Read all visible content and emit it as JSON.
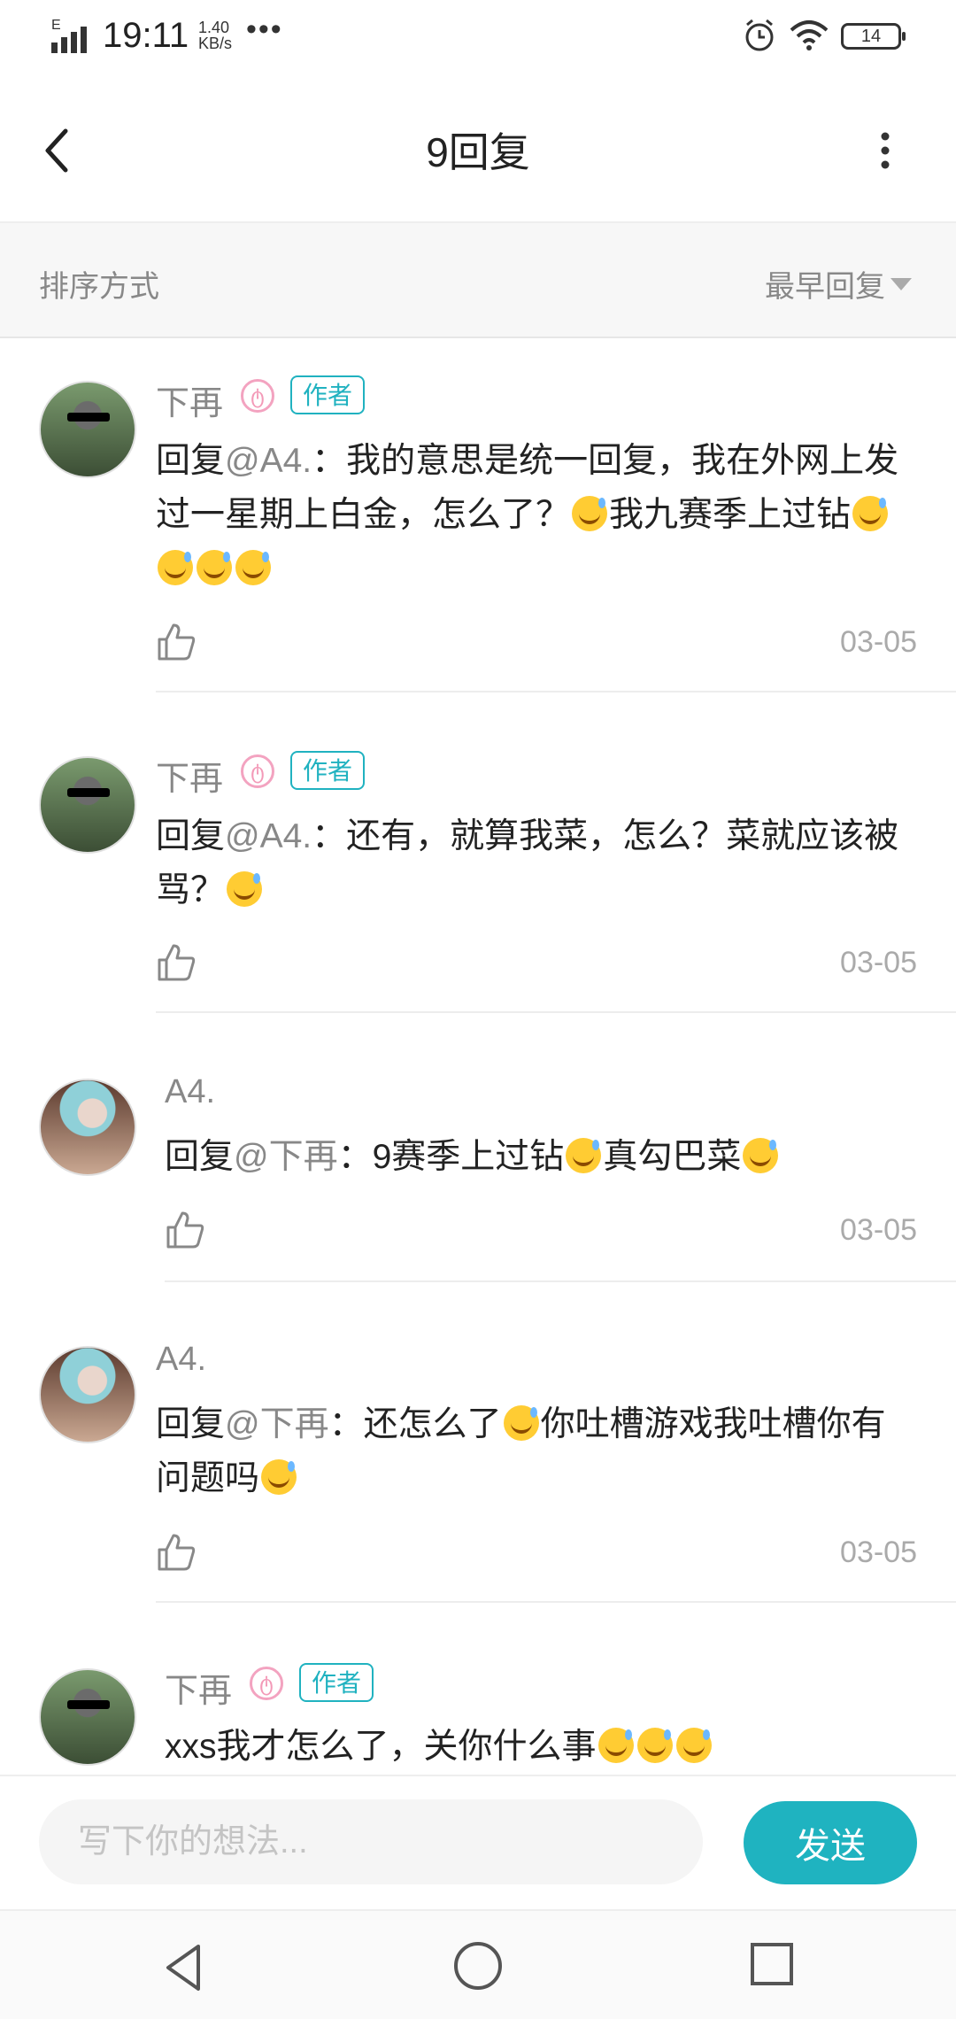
{
  "status_bar": {
    "network": "E",
    "time": "19:11",
    "speed_value": "1.40",
    "speed_unit": "KB/s",
    "more_dots": "•••",
    "battery": "14",
    "icons": [
      "signal-icon",
      "alarm-icon",
      "wifi-icon",
      "battery-icon"
    ]
  },
  "header": {
    "title": "9回复",
    "back_icon": "chevron-left-icon",
    "more_icon": "vertical-ellipsis-icon"
  },
  "sort": {
    "label": "排序方式",
    "value": "最早回复"
  },
  "comments": [
    {
      "user": "下再",
      "vip": "ტ",
      "badge": "作者",
      "reply_prefix": "回复",
      "reply_to": "@A4.",
      "text_segments": [
        "：我的意思是统一回复，我在外网上发过一星期上白金，怎么了？",
        "[emoji]",
        "我九赛季上过钻",
        "[emoji][emoji][emoji][emoji]"
      ],
      "date": "03-05"
    },
    {
      "user": "下再",
      "vip": "ტ",
      "badge": "作者",
      "reply_prefix": "回复",
      "reply_to": "@A4.",
      "text_segments": [
        "：还有，就算我菜，怎么？菜就应该被骂？",
        "[emoji]"
      ],
      "date": "03-05"
    },
    {
      "user": "A4.",
      "reply_prefix": "回复",
      "reply_to": "@下再",
      "text_segments": [
        "：9赛季上过钻",
        "[emoji]",
        "真勾巴菜",
        "[emoji]"
      ],
      "date": "03-05"
    },
    {
      "user": "A4.",
      "reply_prefix": "回复",
      "reply_to": "@下再",
      "text_segments": [
        "：还怎么了",
        "[emoji]",
        "你吐槽游戏我吐槽你有问题吗",
        "[emoji]"
      ],
      "date": "03-05"
    },
    {
      "user": "下再",
      "vip": "ტ",
      "badge": "作者",
      "text_segments": [
        "xxs我才怎么了，关你什么事",
        "[emoji][emoji][emoji]"
      ]
    }
  ],
  "input": {
    "placeholder": "写下你的想法...",
    "send_label": "发送"
  },
  "colors": {
    "accent": "#1fb3c0",
    "muted": "#888888",
    "divider": "#ededed"
  }
}
